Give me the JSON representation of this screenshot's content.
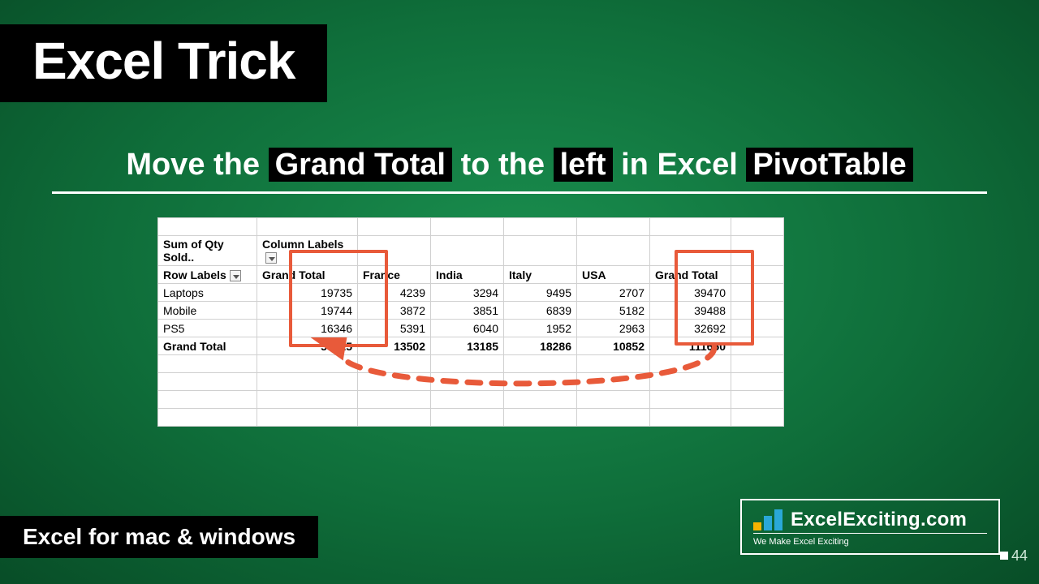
{
  "title": "Excel Trick",
  "subtitle": {
    "p1": "Move the",
    "h1": "Grand Total",
    "p2": "to the",
    "h2": "left",
    "p3": "in Excel",
    "h3": "PivotTable"
  },
  "pivot": {
    "corner": "Sum of Qty Sold..",
    "col_header_caption": "Column Labels",
    "row_header_caption": "Row Labels",
    "columns": [
      "Grand Total",
      "France",
      "India",
      "Italy",
      "USA",
      "Grand Total"
    ],
    "rows": [
      {
        "label": "Laptops",
        "values": [
          19735,
          4239,
          3294,
          9495,
          2707,
          39470
        ]
      },
      {
        "label": "Mobile",
        "values": [
          19744,
          3872,
          3851,
          6839,
          5182,
          39488
        ]
      },
      {
        "label": "PS5",
        "values": [
          16346,
          5391,
          6040,
          1952,
          2963,
          32692
        ]
      }
    ],
    "grand_total": {
      "label": "Grand Total",
      "values": [
        55825,
        13502,
        13185,
        18286,
        10852,
        111650
      ]
    }
  },
  "footer": "Excel for mac & windows",
  "logo": {
    "text": "ExcelExciting.com",
    "tagline": "We Make Excel Exciting"
  },
  "slide_number": "44",
  "highlight_color": "#e85a3a"
}
